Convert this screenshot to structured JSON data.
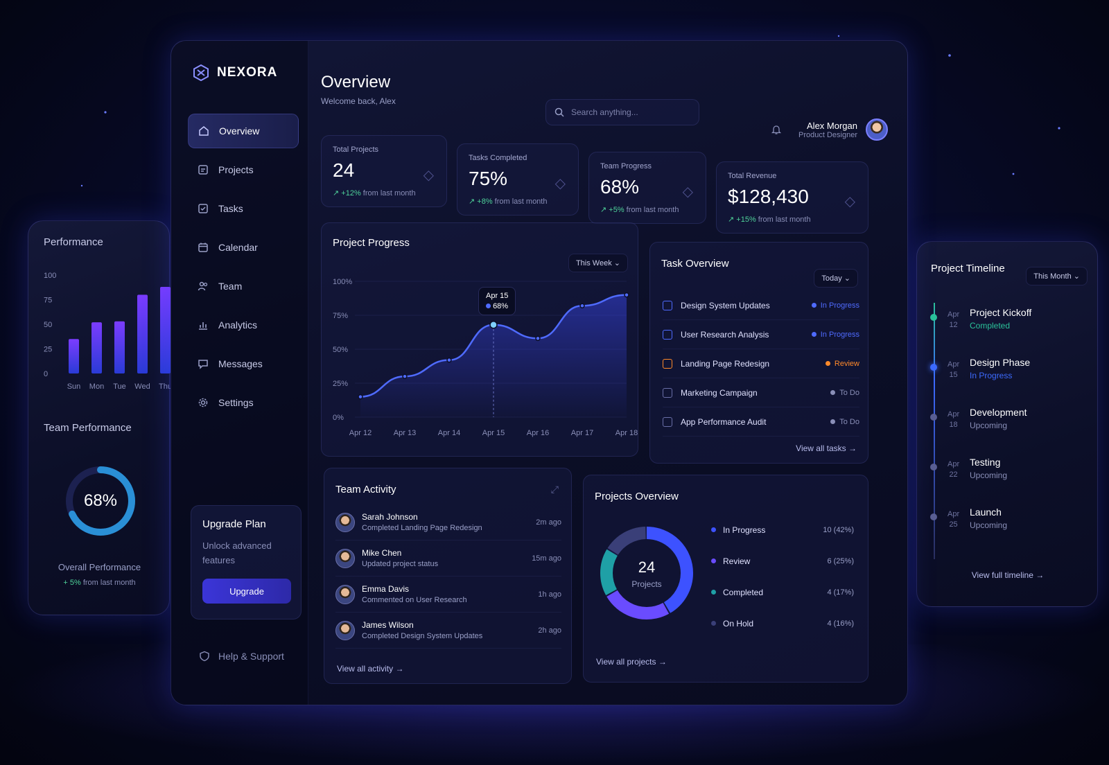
{
  "app": {
    "name": "NEXORA"
  },
  "nav": {
    "items": [
      {
        "label": "Overview",
        "icon": "home-icon",
        "active": true
      },
      {
        "label": "Projects",
        "icon": "clipboard-icon"
      },
      {
        "label": "Tasks",
        "icon": "checklist-icon"
      },
      {
        "label": "Calendar",
        "icon": "calendar-icon"
      },
      {
        "label": "Team",
        "icon": "users-icon"
      },
      {
        "label": "Analytics",
        "icon": "bar-chart-icon"
      },
      {
        "label": "Messages",
        "icon": "message-icon"
      },
      {
        "label": "Settings",
        "icon": "gear-icon"
      }
    ],
    "upgrade": {
      "title": "Upgrade Plan",
      "text": "Unlock advanced features",
      "button": "Upgrade"
    },
    "help": "Help & Support"
  },
  "header": {
    "title": "Overview",
    "subtitle": "Welcome back, Alex",
    "search_placeholder": "Search anything...",
    "user": {
      "name": "Alex Morgan",
      "role": "Product Designer"
    }
  },
  "stats": [
    {
      "label": "Total Projects",
      "value": "24",
      "change": "+12%",
      "suffix": "from last month"
    },
    {
      "label": "Tasks Completed",
      "value": "75%",
      "change": "+8%",
      "suffix": "from last month"
    },
    {
      "label": "Team Progress",
      "value": "68%",
      "change": "+5%",
      "suffix": "from last month"
    },
    {
      "label": "Total Revenue",
      "value": "$128,430",
      "change": "+15%",
      "suffix": "from last month"
    }
  ],
  "project_progress": {
    "title": "Project Progress",
    "range": "This Week",
    "tooltip": {
      "date": "Apr 15",
      "value": "68%"
    },
    "y_ticks": [
      "100%",
      "75%",
      "50%",
      "25%",
      "0%"
    ],
    "x_ticks": [
      "Apr 12",
      "Apr 13",
      "Apr 14",
      "Apr 15",
      "Apr 16",
      "Apr 17",
      "Apr 18"
    ]
  },
  "task_overview": {
    "title": "Task Overview",
    "range": "Today",
    "tasks": [
      {
        "name": "Design System Updates",
        "status": "In Progress",
        "color": "#4f6bff"
      },
      {
        "name": "User Research Analysis",
        "status": "In Progress",
        "color": "#4f6bff"
      },
      {
        "name": "Landing Page Redesign",
        "status": "Review",
        "color": "#ff8a2a"
      },
      {
        "name": "Marketing Campaign",
        "status": "To Do",
        "color": "#8a8fb8"
      },
      {
        "name": "App Performance Audit",
        "status": "To Do",
        "color": "#8a8fb8"
      }
    ],
    "link": "View all tasks"
  },
  "team_activity": {
    "title": "Team Activity",
    "items": [
      {
        "name": "Sarah Johnson",
        "desc": "Completed Landing Page Redesign",
        "time": "2m ago"
      },
      {
        "name": "Mike Chen",
        "desc": "Updated project status",
        "time": "15m ago"
      },
      {
        "name": "Emma Davis",
        "desc": "Commented on User Research",
        "time": "1h ago"
      },
      {
        "name": "James Wilson",
        "desc": "Completed Design System Updates",
        "time": "2h ago"
      }
    ],
    "link": "View all activity"
  },
  "projects_overview": {
    "title": "Projects Overview",
    "center_value": "24",
    "center_label": "Projects",
    "segments": [
      {
        "label": "In Progress",
        "value": "10 (42%)",
        "pct": 42,
        "color": "#3d52ff"
      },
      {
        "label": "Review",
        "value": "6 (25%)",
        "pct": 25,
        "color": "#6a4cff"
      },
      {
        "label": "Completed",
        "value": "4 (17%)",
        "pct": 17,
        "color": "#1fa0a6"
      },
      {
        "label": "On Hold",
        "value": "4 (16%)",
        "pct": 16,
        "color": "#3a3f78"
      }
    ],
    "link": "View all projects"
  },
  "performance": {
    "title": "Performance",
    "y_ticks": [
      "100",
      "75",
      "50",
      "25",
      "0"
    ],
    "team_title": "Team Performance",
    "ring_value": "68%",
    "ring_pct": 68,
    "overall_label": "Overall Performance",
    "overall_change": "+ 5%",
    "overall_suffix": "from last month"
  },
  "timeline": {
    "title": "Project Timeline",
    "range": "This Month",
    "items": [
      {
        "month": "Apr",
        "day": "12",
        "name": "Project Kickoff",
        "status": "Completed",
        "color": "#2bc29a"
      },
      {
        "month": "Apr",
        "day": "15",
        "name": "Design Phase",
        "status": "In Progress",
        "color": "#3d6bff"
      },
      {
        "month": "Apr",
        "day": "18",
        "name": "Development",
        "status": "Upcoming",
        "color": "#5a5f92"
      },
      {
        "month": "Apr",
        "day": "22",
        "name": "Testing",
        "status": "Upcoming",
        "color": "#5a5f92"
      },
      {
        "month": "Apr",
        "day": "25",
        "name": "Launch",
        "status": "Upcoming",
        "color": "#5a5f92"
      }
    ],
    "link": "View full timeline"
  },
  "chart_data": [
    {
      "type": "area",
      "title": "Project Progress",
      "x": [
        "Apr 12",
        "Apr 13",
        "Apr 14",
        "Apr 15",
        "Apr 16",
        "Apr 17",
        "Apr 18"
      ],
      "values": [
        15,
        30,
        42,
        68,
        58,
        82,
        90
      ],
      "ylim": [
        0,
        100
      ],
      "y_unit": "%"
    },
    {
      "type": "bar",
      "title": "Performance",
      "categories": [
        "Sun",
        "Mon",
        "Tue",
        "Wed",
        "Thu"
      ],
      "values": [
        35,
        52,
        53,
        80,
        88
      ],
      "ylim": [
        0,
        100
      ]
    }
  ]
}
